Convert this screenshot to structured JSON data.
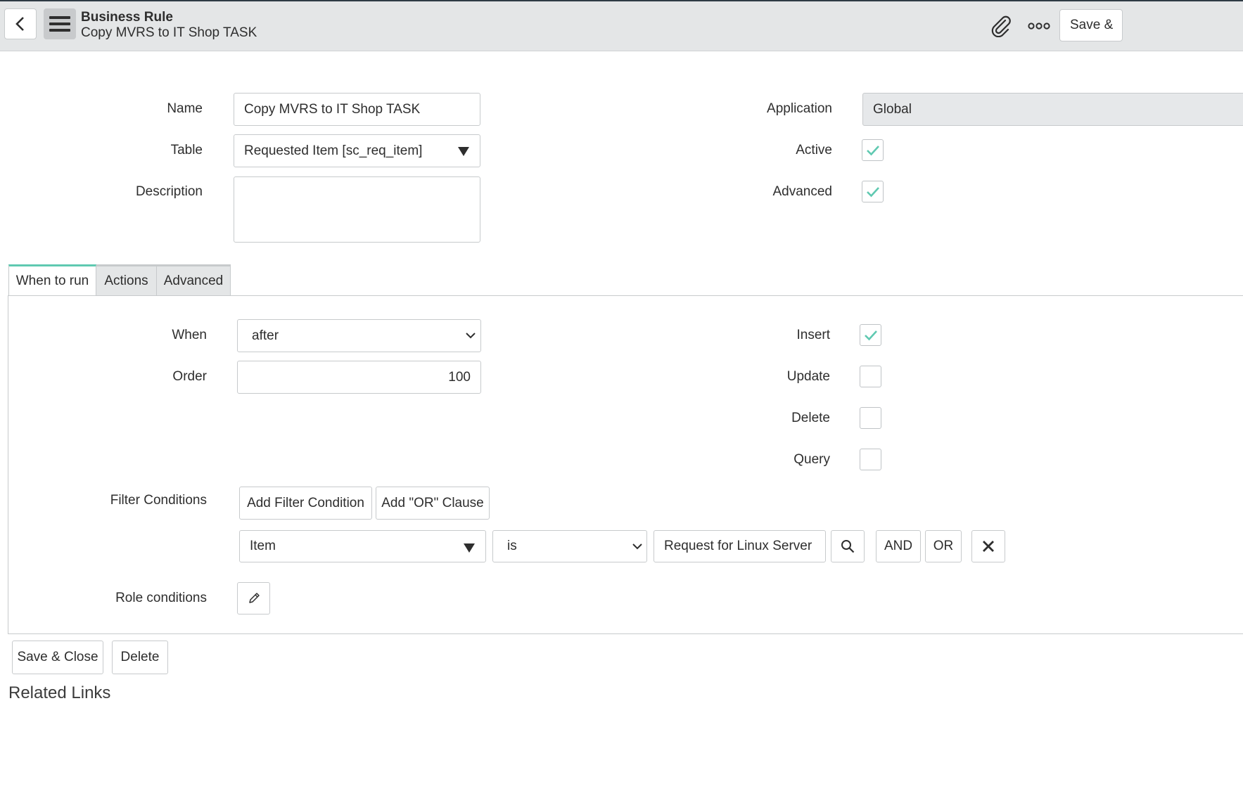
{
  "header": {
    "record_type": "Business Rule",
    "record_name": "Copy MVRS to IT Shop TASK",
    "save_label": "Save &"
  },
  "form": {
    "name_label": "Name",
    "name_value": "Copy MVRS to IT Shop TASK",
    "table_label": "Table",
    "table_value": "Requested Item [sc_req_item]",
    "description_label": "Description",
    "description_value": "",
    "application_label": "Application",
    "application_value": "Global",
    "active_label": "Active",
    "active_checked": true,
    "advanced_label": "Advanced",
    "advanced_checked": true
  },
  "tabs": [
    {
      "label": "When to run",
      "active": true
    },
    {
      "label": "Actions",
      "active": false
    },
    {
      "label": "Advanced",
      "active": false
    }
  ],
  "when_to_run": {
    "when_label": "When",
    "when_value": "after",
    "order_label": "Order",
    "order_value": "100",
    "insert_label": "Insert",
    "insert_checked": true,
    "update_label": "Update",
    "update_checked": false,
    "delete_label": "Delete",
    "delete_checked": false,
    "query_label": "Query",
    "query_checked": false,
    "filter_label": "Filter Conditions",
    "add_filter_label": "Add Filter Condition",
    "add_or_label": "Add \"OR\" Clause",
    "condition_field": "Item",
    "condition_operator": "is",
    "condition_value": "Request for Linux Server",
    "and_label": "AND",
    "or_label": "OR",
    "role_label": "Role conditions"
  },
  "footer": {
    "save_close_label": "Save & Close",
    "delete_label": "Delete",
    "related_links": "Related Links"
  },
  "colors": {
    "accent": "#5fc9b1",
    "header_bg": "#e4e6e7"
  }
}
